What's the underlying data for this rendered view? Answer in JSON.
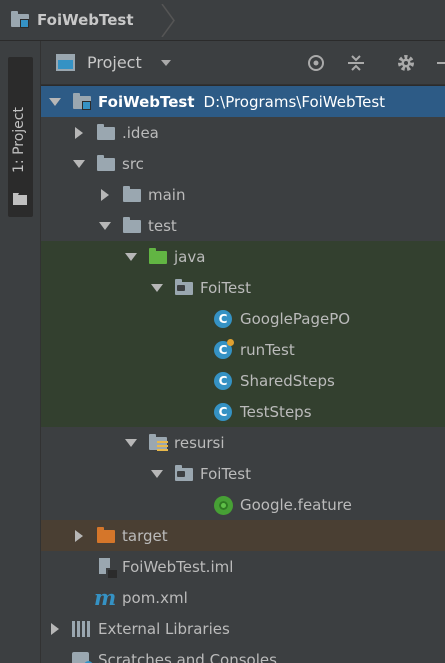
{
  "navbar": {
    "project_name": "FoiWebTest"
  },
  "stripe": {
    "tab_label": "1: Project"
  },
  "panel": {
    "view_label": "Project",
    "icons": [
      "locate-icon",
      "collapse-all-icon",
      "gear-icon",
      "hide-icon"
    ]
  },
  "colors": {
    "selection": "#2d5b86",
    "test_folder_bg": "#33402f",
    "excluded_bg": "#4a3f33",
    "panel_bg": "#3c3f41",
    "accent_blue": "#3592c4",
    "test_green": "#62b543",
    "excluded_orange": "#d5762a"
  },
  "tree": {
    "root": {
      "label": "FoiWebTest",
      "path": "D:\\Programs\\FoiWebTest",
      "icon": "module-folder-icon"
    },
    "idea": {
      "label": ".idea",
      "icon": "folder-icon"
    },
    "src": {
      "label": "src",
      "icon": "folder-icon"
    },
    "main": {
      "label": "main",
      "icon": "folder-icon"
    },
    "test": {
      "label": "test",
      "icon": "folder-icon"
    },
    "java": {
      "label": "java",
      "icon": "test-source-folder-icon"
    },
    "foitest_java": {
      "label": "FoiTest",
      "icon": "package-icon"
    },
    "googlepagepo": {
      "label": "GooglePagePO",
      "icon": "class-icon"
    },
    "runtest": {
      "label": "runTest",
      "icon": "class-run-icon"
    },
    "sharedsteps": {
      "label": "SharedSteps",
      "icon": "class-icon"
    },
    "teststeps": {
      "label": "TestSteps",
      "icon": "class-icon"
    },
    "resursi": {
      "label": "resursi",
      "icon": "resources-folder-icon"
    },
    "foitest_res": {
      "label": "FoiTest",
      "icon": "package-icon"
    },
    "google_feature": {
      "label": "Google.feature",
      "icon": "cucumber-icon"
    },
    "target": {
      "label": "target",
      "icon": "excluded-folder-icon"
    },
    "iml": {
      "label": "FoiWebTest.iml",
      "icon": "iml-file-icon"
    },
    "pom": {
      "label": "pom.xml",
      "icon": "maven-icon"
    },
    "ext_libs": {
      "label": "External Libraries",
      "icon": "libraries-icon"
    },
    "scratches": {
      "label": "Scratches and Consoles",
      "icon": "scratches-icon"
    }
  }
}
